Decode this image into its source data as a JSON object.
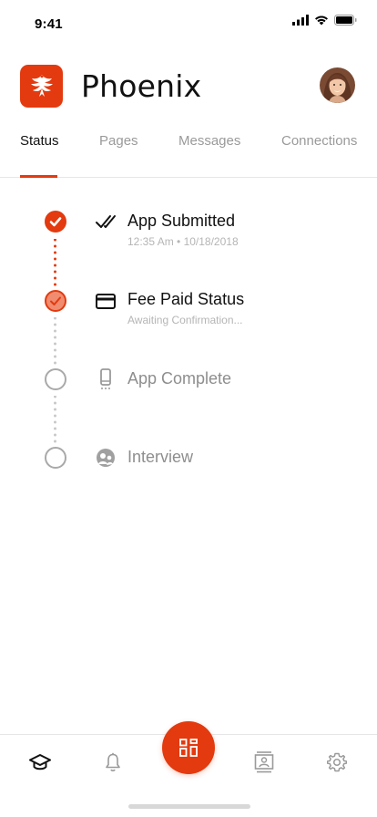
{
  "status_bar": {
    "time": "9:41"
  },
  "header": {
    "title": "Phoenix"
  },
  "tabs": [
    {
      "label": "Status",
      "active": true
    },
    {
      "label": "Pages",
      "active": false
    },
    {
      "label": "Messages",
      "active": false
    },
    {
      "label": "Connections",
      "active": false
    }
  ],
  "timeline": [
    {
      "title": "App Submitted",
      "subtitle": "12:35 Am • 10/18/2018",
      "state": "completed",
      "icon": "checkmark-icon"
    },
    {
      "title": "Fee Paid Status",
      "subtitle": "Awaiting Confirmation...",
      "state": "in-progress",
      "icon": "credit-card-icon"
    },
    {
      "title": "App Complete",
      "state": "not-started",
      "icon": "mobile-phone-icon"
    },
    {
      "title": "Interview",
      "state": "not-started",
      "icon": "people-icon"
    }
  ],
  "bottom_nav": [
    {
      "icon": "graduation-cap-icon",
      "active": true
    },
    {
      "icon": "bell-icon",
      "active": false
    },
    {
      "icon": "qr-grid-icon",
      "active": false
    },
    {
      "icon": "contact-card-icon",
      "active": false
    },
    {
      "icon": "gear-icon",
      "active": false
    }
  ],
  "colors": {
    "accent": "#e33a0f",
    "accent_light": "#f08c70",
    "text_primary": "#111111",
    "text_muted": "#9a9a9a",
    "text_subtle": "#b5b5b5",
    "divider": "#e6e6e6"
  }
}
